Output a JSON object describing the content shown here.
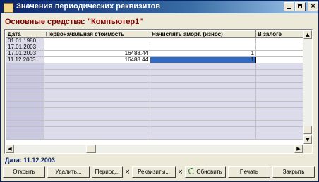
{
  "window": {
    "title": "Значения периодических реквизитов",
    "title_icon": "document-icon"
  },
  "titlebar_buttons": [
    {
      "name": "minimize",
      "label": ""
    },
    {
      "name": "maximize",
      "label": ""
    },
    {
      "name": "close",
      "label": "×"
    }
  ],
  "header": {
    "subtitle": "Основные средства: \"Компьютер1\""
  },
  "grid": {
    "columns": [
      "Дата",
      "Первоначальная стоимость",
      "Начислять аморт. (износ)",
      "В залоге"
    ],
    "rows": [
      [
        "01.01.1980",
        "",
        "",
        ""
      ],
      [
        "17.01.2003",
        "",
        "",
        ""
      ],
      [
        "17.01.2003",
        "16488.44",
        "1",
        ""
      ],
      [
        "11.12.2003",
        "16488.44",
        "1",
        ""
      ]
    ],
    "selected_row": 3,
    "selected_col": 2
  },
  "status": {
    "text": "Дата: 11.12.2003"
  },
  "buttons": {
    "open": "Открыть",
    "delete": "Удалить...",
    "period": "Период...",
    "period_clear": "×",
    "requisites": "Реквизиты...",
    "requisites_clear": "×",
    "refresh": "Обновить",
    "print": "Печать",
    "close": "Закрыть"
  },
  "colors": {
    "title_bar": "#0a246a",
    "subtitle": "#800000",
    "selection": "#316ac5",
    "empty_row": "#dcdcec"
  }
}
